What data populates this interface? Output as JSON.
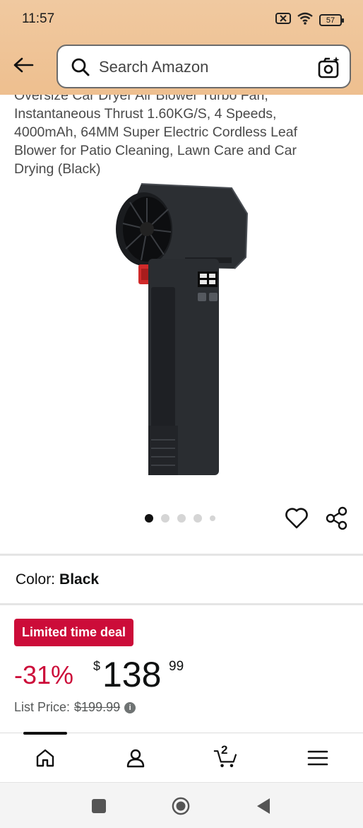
{
  "status_bar": {
    "time": "11:57",
    "battery": "57",
    "icons": [
      "sim-off-icon",
      "wifi-icon",
      "battery-icon"
    ]
  },
  "search": {
    "placeholder": "Search Amazon"
  },
  "product": {
    "title": "Oversize Car Dryer Air Blower Turbo Fan, Instantaneous Thrust 1.60KG/S, 4 Speeds, 4000mAh, 64MM Super Electric Cordless Leaf Blower for Patio Cleaning, Lawn Care and Car Drying (Black)",
    "image_dots": 5,
    "active_dot": 1
  },
  "variation": {
    "color_label": "Color:",
    "color_value": "Black"
  },
  "deal": {
    "badge": "Limited time deal",
    "discount": "-31%",
    "currency": "$",
    "price_whole": "138",
    "price_fraction": "99",
    "list_price_label": "List Price:",
    "list_price_value": "$199.99"
  },
  "bottom_nav": {
    "items": [
      "home-icon",
      "account-icon",
      "cart-icon",
      "menu-icon"
    ],
    "cart_count": "2"
  },
  "colors": {
    "header": "#eebf8f",
    "deal_red": "#cc0c39"
  }
}
